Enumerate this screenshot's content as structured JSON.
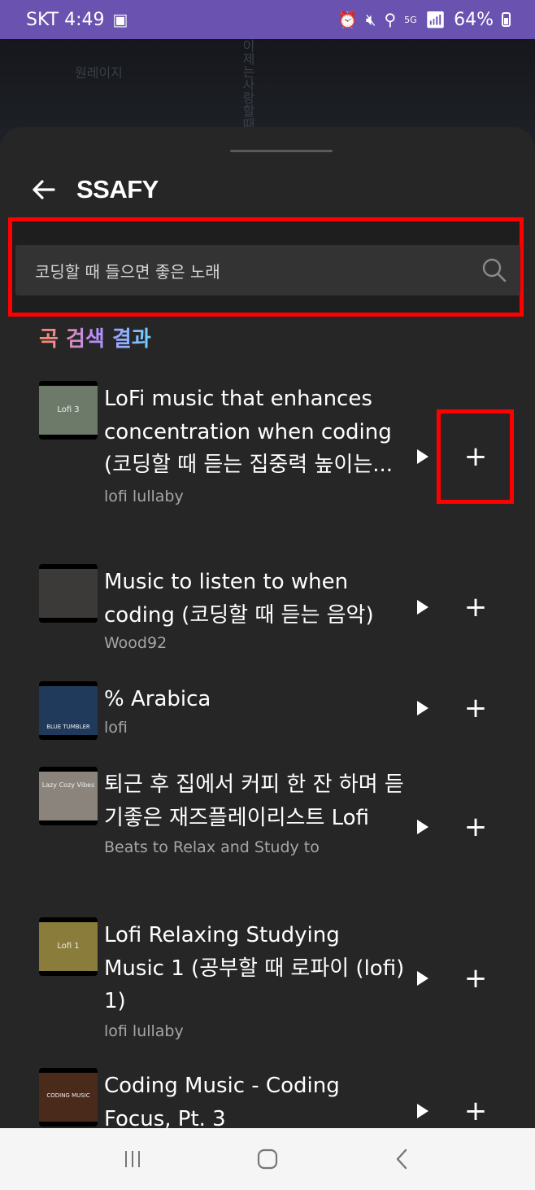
{
  "status_bar": {
    "carrier_time": "SKT 4:49",
    "network": "5G",
    "battery": "64%"
  },
  "backdrop": {
    "text_left": "원레이지",
    "text_right": "이제는사랑할때"
  },
  "header": {
    "title": "SSAFY",
    "back_icon": "arrow-left-icon"
  },
  "search": {
    "value": "코딩할 때 들으면 좋은 노래",
    "icon": "search-icon"
  },
  "results": {
    "section_title": "곡 검색 결과",
    "items": [
      {
        "title": "LoFi music that enhances concentration when coding (코딩할 때 듣는 집중력 높이는...",
        "artist": "lofi lullaby",
        "thumb_label": "Lofi 3",
        "thumb_color": "#6d7a6a"
      },
      {
        "title": "Music to listen to when coding (코딩할 때 듣는 음악)",
        "artist": "Wood92",
        "thumb_label": "",
        "thumb_color": "#3b3a38"
      },
      {
        "title": "% Arabica",
        "artist": "lofi",
        "thumb_label": "BLUE TUMBLER",
        "thumb_color": "#e9e9e9"
      },
      {
        "title": "퇴근 후 집에서 커피 한 잔 하며 듣기좋은 재즈플레이리스트 Lofi",
        "artist": "Beats to Relax and Study to",
        "thumb_label": "Lazy Cozy Vibes",
        "thumb_color": "#b9b3aa"
      },
      {
        "title": "Lofi Relaxing Studying Music 1 (공부할 때 로파이 (lofi) 1)",
        "artist": "lofi lullaby",
        "thumb_label": "Lofi 1",
        "thumb_color": "#8a7c3a"
      },
      {
        "title": "Coding Music - Coding Focus, Pt. 3",
        "artist": "",
        "thumb_label": "CODING MUSIC",
        "thumb_color": "#4a2a1a"
      }
    ],
    "play_icon": "play-icon",
    "add_icon": "plus-icon",
    "add_label": "+"
  },
  "nav_bar": {
    "recents_icon": "recents-icon",
    "home_icon": "home-icon",
    "back_icon": "back-chevron-icon"
  }
}
